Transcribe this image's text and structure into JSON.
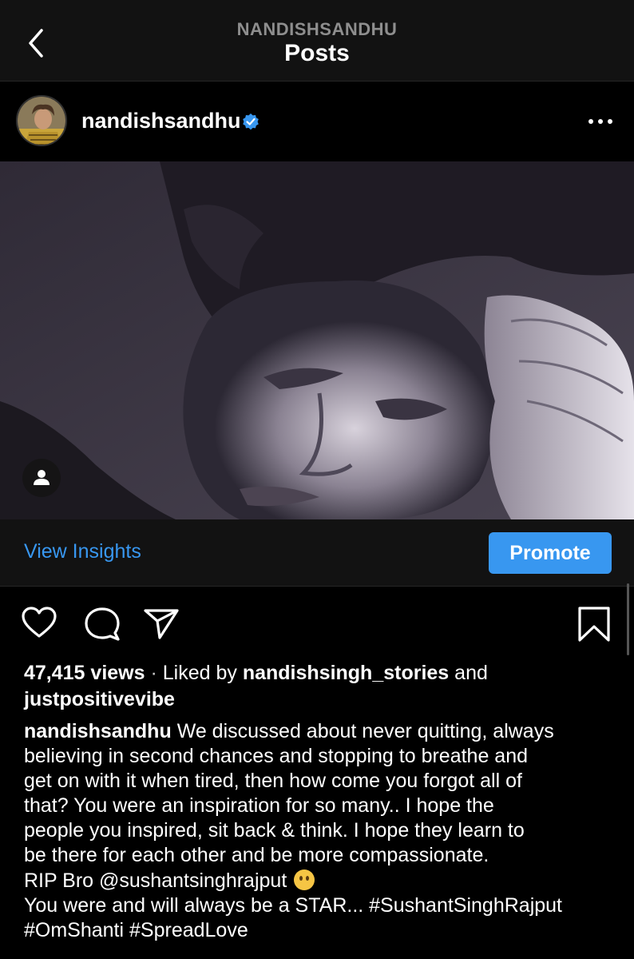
{
  "header": {
    "account": "NANDISHSANDHU",
    "title": "Posts"
  },
  "post": {
    "username": "nandishsandhu",
    "verified": true,
    "view_insights": "View Insights",
    "promote": "Promote",
    "views": "47,415 views",
    "separator": "·",
    "liked_by_prefix": "Liked by",
    "liked_by_user": "nandishsingh_stories",
    "liked_by_and": "and",
    "liked_by_other": "justpositivevibe",
    "caption_username": "nandishsandhu",
    "caption_lines": [
      "We discussed about never quitting, always",
      "believing in second chances and stopping to breathe and",
      "get on with it when tired, then how come you forgot all of",
      "that? You were an inspiration for so many.. I hope the",
      "people you inspired, sit back & think. I hope they learn to",
      "be there for each other and be more compassionate."
    ],
    "rip_line": "RIP Bro @sushantsinghrajput",
    "star_line": "You were and will always be a STAR... #SushantSinghRajput",
    "hashtags_line": "#OmShanti #SpreadLove"
  },
  "icons": {
    "back": "chevron-left-icon",
    "verified": "verified-badge-icon",
    "more": "more-options-icon",
    "tag": "tagged-person-icon",
    "like": "heart-icon",
    "comment": "comment-icon",
    "share": "paper-plane-icon",
    "save": "bookmark-icon"
  },
  "colors": {
    "accent": "#3897f0",
    "background": "#000000",
    "header_bg": "#121212",
    "muted_text": "#8e8e8e"
  }
}
